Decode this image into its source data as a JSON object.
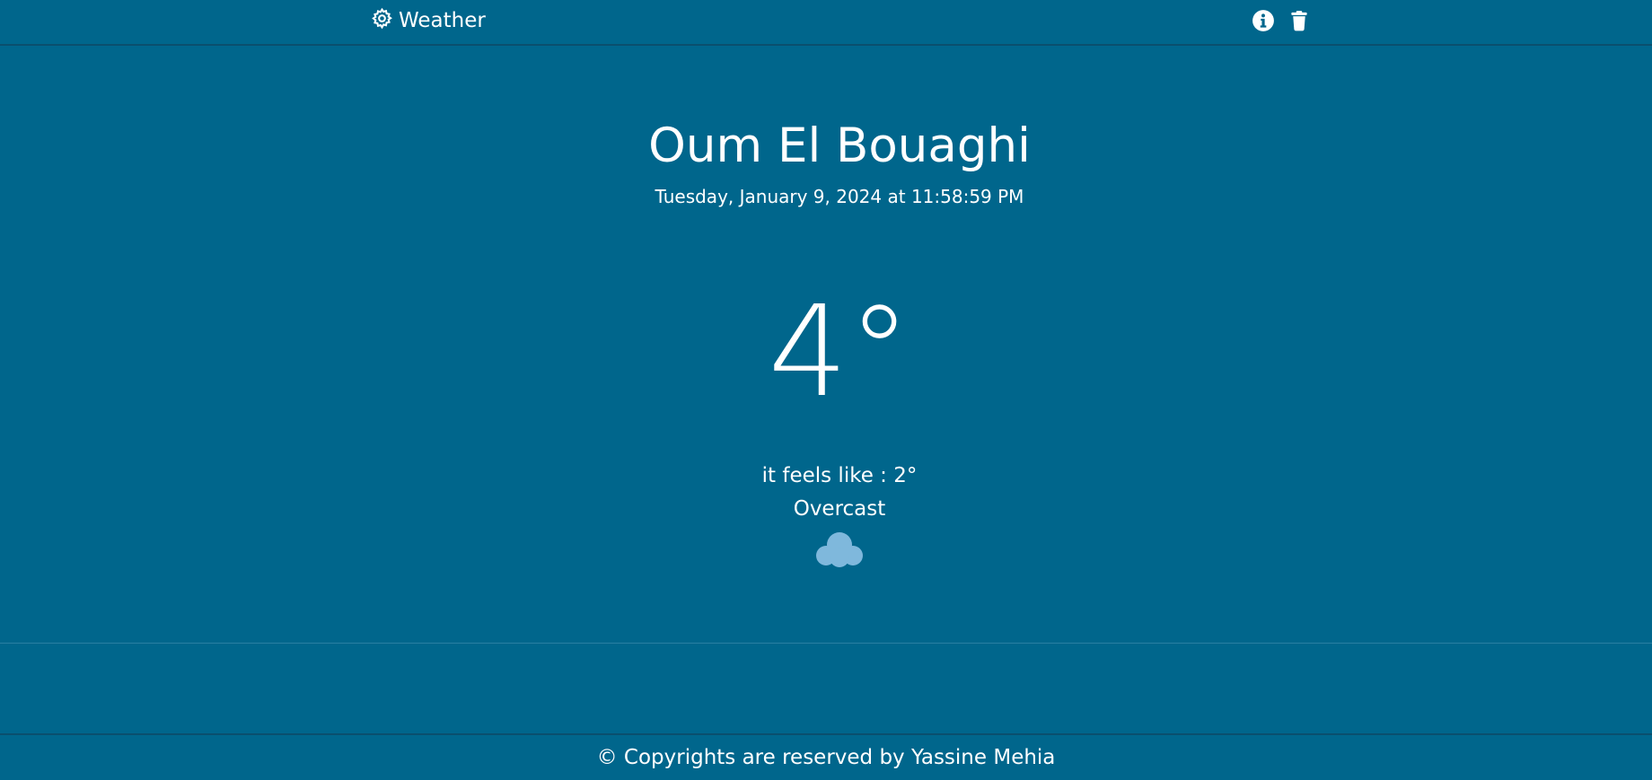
{
  "nav": {
    "brand_label": "Weather",
    "brand_icon": "gear-icon",
    "info_icon": "info-icon",
    "delete_icon": "trash-icon"
  },
  "weather": {
    "city": "Oum El Bouaghi",
    "datetime": "Tuesday, January 9, 2024 at 11:58:59 PM",
    "temperature": "4°",
    "feels_like": "it feels like : 2°",
    "condition": "Overcast",
    "condition_icon": "cloud-icon"
  },
  "footer": {
    "text": "© Copyrights are reserved by Yassine Mehia"
  },
  "colors": {
    "background": "#00668c",
    "text": "#ffffff",
    "cloud": "#7fb8dc",
    "border": "#0a4f6e"
  }
}
